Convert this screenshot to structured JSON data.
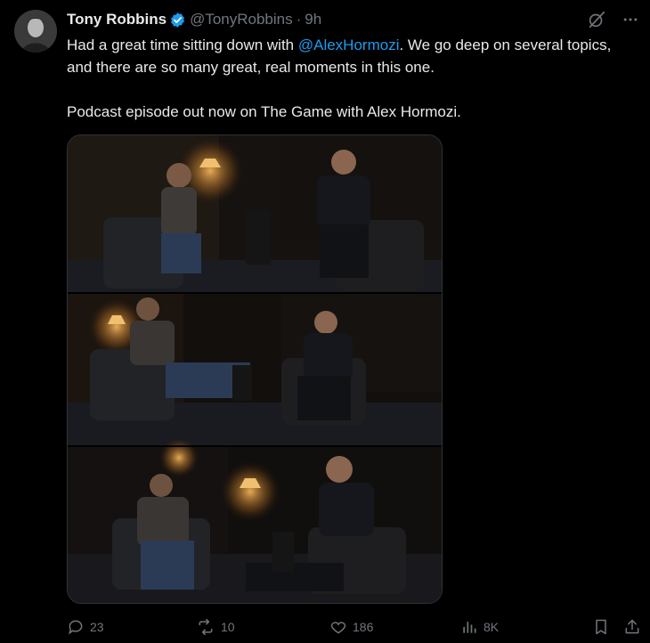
{
  "author": {
    "name": "Tony Robbins",
    "handle": "@TonyRobbins",
    "separator": "·",
    "time": "9h",
    "verified": true,
    "verified_color": "#1d9bf0"
  },
  "tweet": {
    "line1_before": "Had a great time sitting down with ",
    "mention": "@AlexHormozi",
    "line1_after": ". We go deep on several topics, and there are so many great, real moments in this one.",
    "paragraph2": "Podcast episode out now on The Game with Alex Hormozi."
  },
  "media": {
    "panels": 3,
    "description_icon": "photo-collage"
  },
  "actions": {
    "replies": "23",
    "reposts": "10",
    "likes": "186",
    "views": "8K"
  },
  "icons": {
    "grok": "grok-icon",
    "more": "more-icon",
    "reply": "reply-icon",
    "repost": "repost-icon",
    "like": "heart-icon",
    "views": "views-icon",
    "bookmark": "bookmark-icon",
    "share": "share-icon"
  },
  "colors": {
    "background": "#000000",
    "text": "#e7e9ea",
    "muted": "#71767b",
    "accent": "#1d9bf0"
  }
}
